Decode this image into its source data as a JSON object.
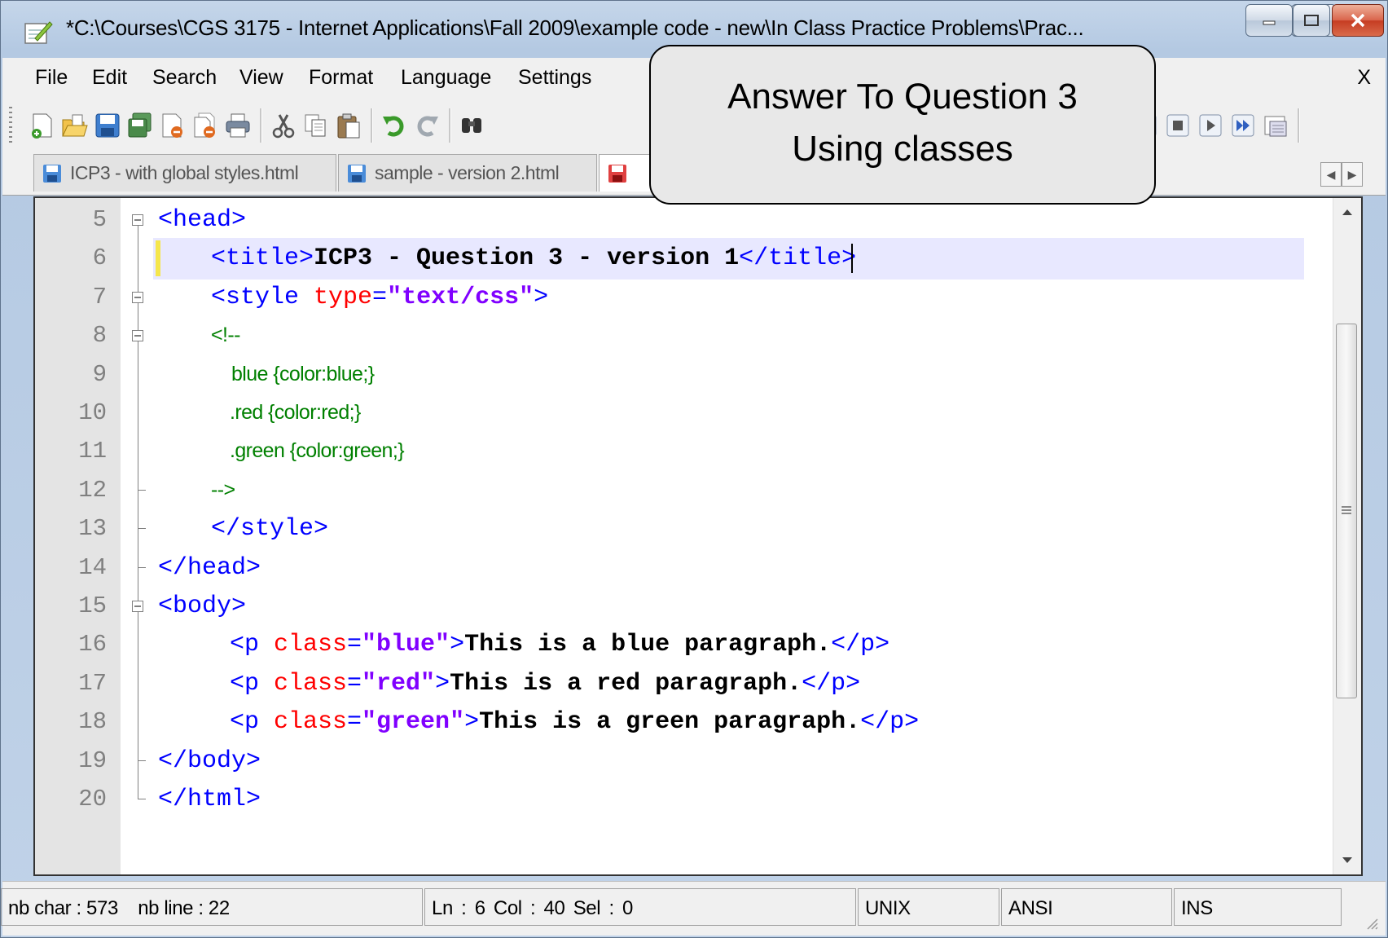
{
  "window": {
    "title": "*C:\\Courses\\CGS 3175 - Internet Applications\\Fall 2009\\example code - new\\In Class Practice Problems\\Prac..."
  },
  "menu": {
    "items": [
      "File",
      "Edit",
      "Search",
      "View",
      "Format",
      "Language",
      "Settings"
    ],
    "close_label": "X"
  },
  "tabs": [
    {
      "label": "ICP3 - with global styles.html",
      "color": "#4a8cd9"
    },
    {
      "label": "sample - version 2.html",
      "color": "#4a8cd9"
    },
    {
      "label": "",
      "color": "#e04040"
    }
  ],
  "callout": {
    "line1": "Answer To Question 3",
    "line2": "Using classes"
  },
  "editor": {
    "lines": [
      {
        "num": "5",
        "tokens": [
          {
            "t": "tag",
            "v": "<head>"
          }
        ]
      },
      {
        "num": "6",
        "tokens": [
          {
            "t": "tag",
            "v": "<title>"
          },
          {
            "t": "txt",
            "v": "ICP3 - Question 3 - version 1"
          },
          {
            "t": "tag",
            "v": "</title>"
          }
        ]
      },
      {
        "num": "7",
        "tokens": [
          {
            "t": "tag",
            "v": "<style "
          },
          {
            "t": "attr",
            "v": "type"
          },
          {
            "t": "tag",
            "v": "="
          },
          {
            "t": "str",
            "v": "\"text/css\""
          },
          {
            "t": "tag",
            "v": ">"
          }
        ]
      },
      {
        "num": "8",
        "css": "<!--"
      },
      {
        "num": "9",
        "css": "blue {color:blue;}"
      },
      {
        "num": "10",
        "css": ".red {color:red;}"
      },
      {
        "num": "11",
        "css": ".green {color:green;}"
      },
      {
        "num": "12",
        "css": "-->"
      },
      {
        "num": "13",
        "tokens": [
          {
            "t": "tag",
            "v": "</style>"
          }
        ]
      },
      {
        "num": "14",
        "tokens": [
          {
            "t": "tag",
            "v": "</head>"
          }
        ]
      },
      {
        "num": "15",
        "tokens": [
          {
            "t": "tag",
            "v": "<body>"
          }
        ]
      },
      {
        "num": "16",
        "tokens": [
          {
            "t": "tag",
            "v": "<p "
          },
          {
            "t": "attr",
            "v": "class"
          },
          {
            "t": "tag",
            "v": "="
          },
          {
            "t": "str",
            "v": "\"blue\""
          },
          {
            "t": "tag",
            "v": ">"
          },
          {
            "t": "txt",
            "v": "This is a blue paragraph."
          },
          {
            "t": "tag",
            "v": "</p>"
          }
        ]
      },
      {
        "num": "17",
        "tokens": [
          {
            "t": "tag",
            "v": "<p "
          },
          {
            "t": "attr",
            "v": "class"
          },
          {
            "t": "tag",
            "v": "="
          },
          {
            "t": "str",
            "v": "\"red\""
          },
          {
            "t": "tag",
            "v": ">"
          },
          {
            "t": "txt",
            "v": "This is a red paragraph."
          },
          {
            "t": "tag",
            "v": "</p>"
          }
        ]
      },
      {
        "num": "18",
        "tokens": [
          {
            "t": "tag",
            "v": "<p "
          },
          {
            "t": "attr",
            "v": "class"
          },
          {
            "t": "tag",
            "v": "="
          },
          {
            "t": "str",
            "v": "\"green\""
          },
          {
            "t": "tag",
            "v": ">"
          },
          {
            "t": "txt",
            "v": "This is a green paragraph."
          },
          {
            "t": "tag",
            "v": "</p>"
          }
        ]
      },
      {
        "num": "19",
        "tokens": [
          {
            "t": "tag",
            "v": "</body>"
          }
        ]
      },
      {
        "num": "20",
        "tokens": [
          {
            "t": "tag",
            "v": "</html>"
          }
        ]
      }
    ]
  },
  "status": {
    "nb_char": "nb char : 573",
    "nb_line": "nb line : 22",
    "position": "Ln : 6    Col : 40    Sel : 0",
    "eol": "UNIX",
    "encoding": "ANSI",
    "mode": "INS"
  }
}
